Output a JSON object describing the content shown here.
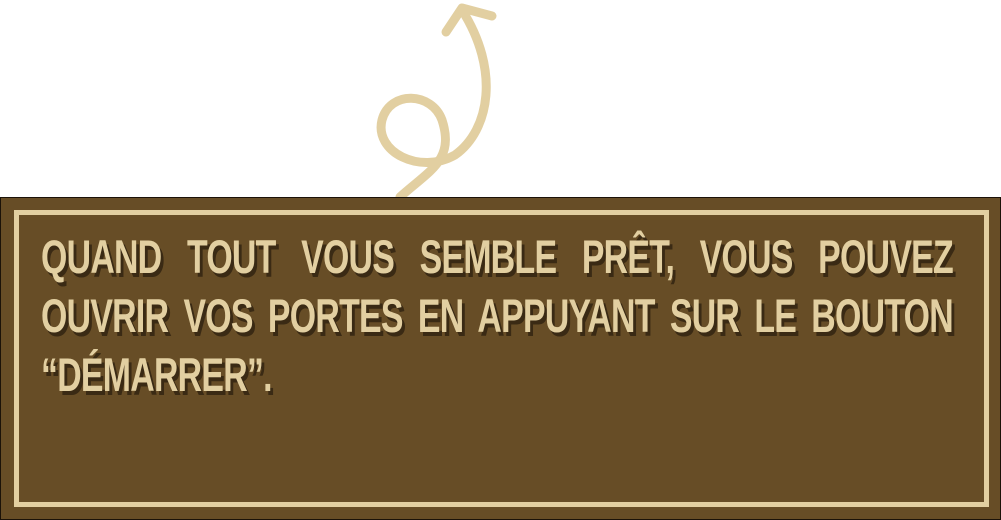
{
  "panel": {
    "message": "Quand tout vous semble prêt, vous pouvez ouvrir vos portes en appuyant sur le bouton “démarrer”."
  },
  "colors": {
    "panel_background": "#674d26",
    "frame_and_text": "#e2cfa1",
    "text_shadow": "#3a2a14",
    "arrow": "#e2cfa1"
  },
  "icons": {
    "arrow": "curly-up-arrow-icon"
  }
}
